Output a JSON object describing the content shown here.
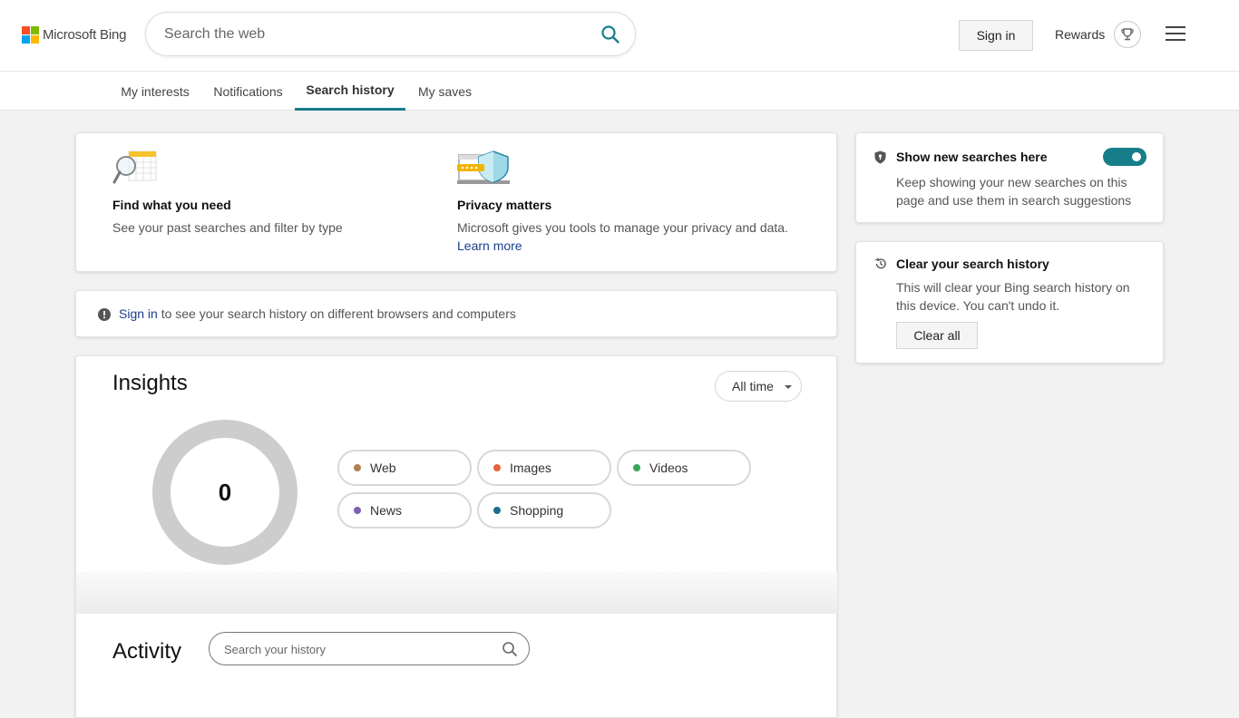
{
  "header": {
    "logo_text": "Microsoft Bing",
    "search_placeholder": "Search the web",
    "signin_label": "Sign in",
    "rewards_label": "Rewards"
  },
  "tabs": [
    {
      "label": "My interests",
      "active": false
    },
    {
      "label": "Notifications",
      "active": false
    },
    {
      "label": "Search history",
      "active": true
    },
    {
      "label": "My saves",
      "active": false
    }
  ],
  "intro": {
    "find": {
      "title": "Find what you need",
      "text": "See your past searches and filter by type"
    },
    "privacy": {
      "title": "Privacy matters",
      "text": "Microsoft gives you tools to manage your privacy and data.",
      "link": "Learn more"
    }
  },
  "signin_notice": {
    "link": "Sign in",
    "text": " to see your search history on different browsers and computers"
  },
  "insights": {
    "title": "Insights",
    "range": "All time",
    "total": "0",
    "categories": [
      {
        "label": "Web",
        "color": "#b07f4e"
      },
      {
        "label": "Images",
        "color": "#e8623c"
      },
      {
        "label": "Videos",
        "color": "#3aa55a"
      },
      {
        "label": "News",
        "color": "#8060b0"
      },
      {
        "label": "Shopping",
        "color": "#1b6f8e"
      }
    ]
  },
  "activity": {
    "title": "Activity",
    "search_placeholder": "Search your history"
  },
  "side": {
    "show_new": {
      "title": "Show new searches here",
      "text": "Keep showing your new searches on this page and use them in search suggestions",
      "enabled": true
    },
    "clear": {
      "title": "Clear your search history",
      "text": "This will clear your Bing search history on this device. You can't undo it.",
      "button": "Clear all"
    }
  },
  "colors": {
    "accent": "#177e89",
    "link": "#1a3e8c"
  }
}
